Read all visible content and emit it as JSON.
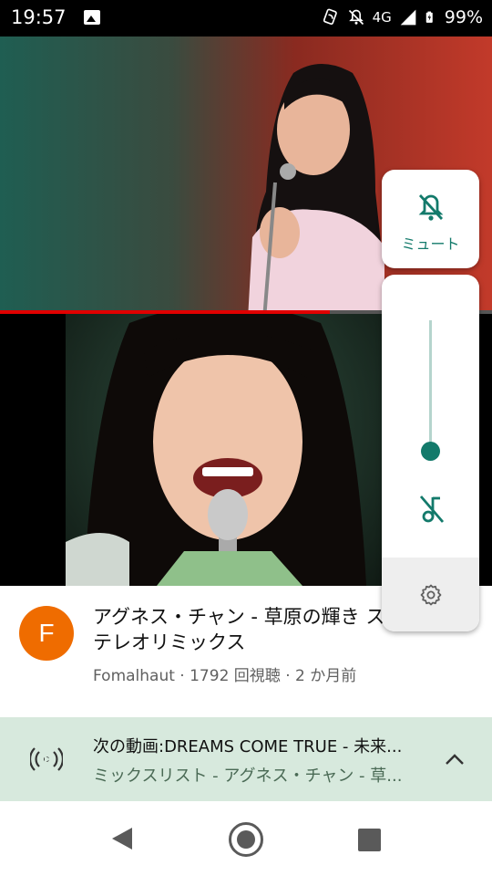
{
  "status_bar": {
    "time": "19:57",
    "network": "4G",
    "battery": "99%",
    "icons": [
      "photo-icon",
      "nfc-icon",
      "bell-off-icon",
      "signal-icon",
      "battery-charging-icon"
    ]
  },
  "player": {
    "progress_fraction": 0.67,
    "progress_color": "#e00000"
  },
  "video": {
    "channel_initial": "F",
    "title_line1": "アグネス・チャン - 草原の輝き ス",
    "title_line2": "テレオリミックス",
    "meta": "Fomalhaut · 1792 回視聴 · 2 か月前",
    "avatar_color": "#ef6c00"
  },
  "next_up": {
    "title": "次の動画:DREAMS COME TRUE - 未来...",
    "subtitle": "ミックスリスト - アグネス・チャン - 草...",
    "icon": "cast-icon",
    "chevron": "chevron-up-icon"
  },
  "volume_panel": {
    "mute_label": "ミュート",
    "level_fraction": 0.0,
    "accent_color": "#137a6b",
    "icons": [
      "bell-off-icon",
      "music-off-icon",
      "gear-icon"
    ]
  },
  "nav": {
    "icons": [
      "back-icon",
      "home-icon",
      "recents-icon"
    ]
  }
}
